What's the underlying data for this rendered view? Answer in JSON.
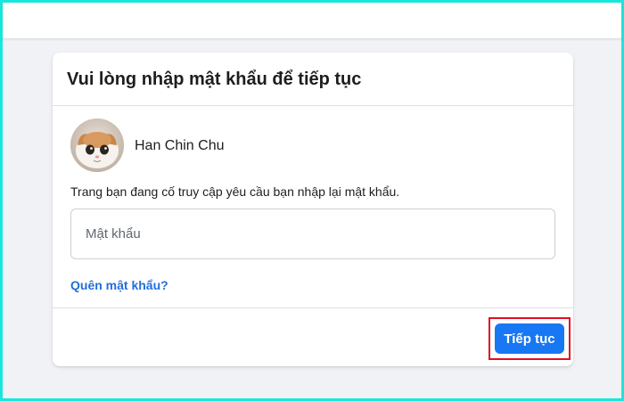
{
  "dialog": {
    "title": "Vui lòng nhập mật khẩu để tiếp tục",
    "user_name": "Han Chin Chu",
    "description": "Trang bạn đang cố truy cập yêu cầu bạn nhập lại mật khẩu.",
    "password_value": "",
    "password_placeholder": "Mật khẩu",
    "forgot_password_link": "Quên mật khẩu?",
    "continue_button": "Tiếp tục"
  },
  "colors": {
    "primary": "#1877f2",
    "link": "#216fdb",
    "highlight_border": "#e0101f",
    "page_background": "#f0f2f5",
    "frame_border": "#19e6dc"
  },
  "icons": {
    "avatar": "user-avatar-cat-photo"
  }
}
